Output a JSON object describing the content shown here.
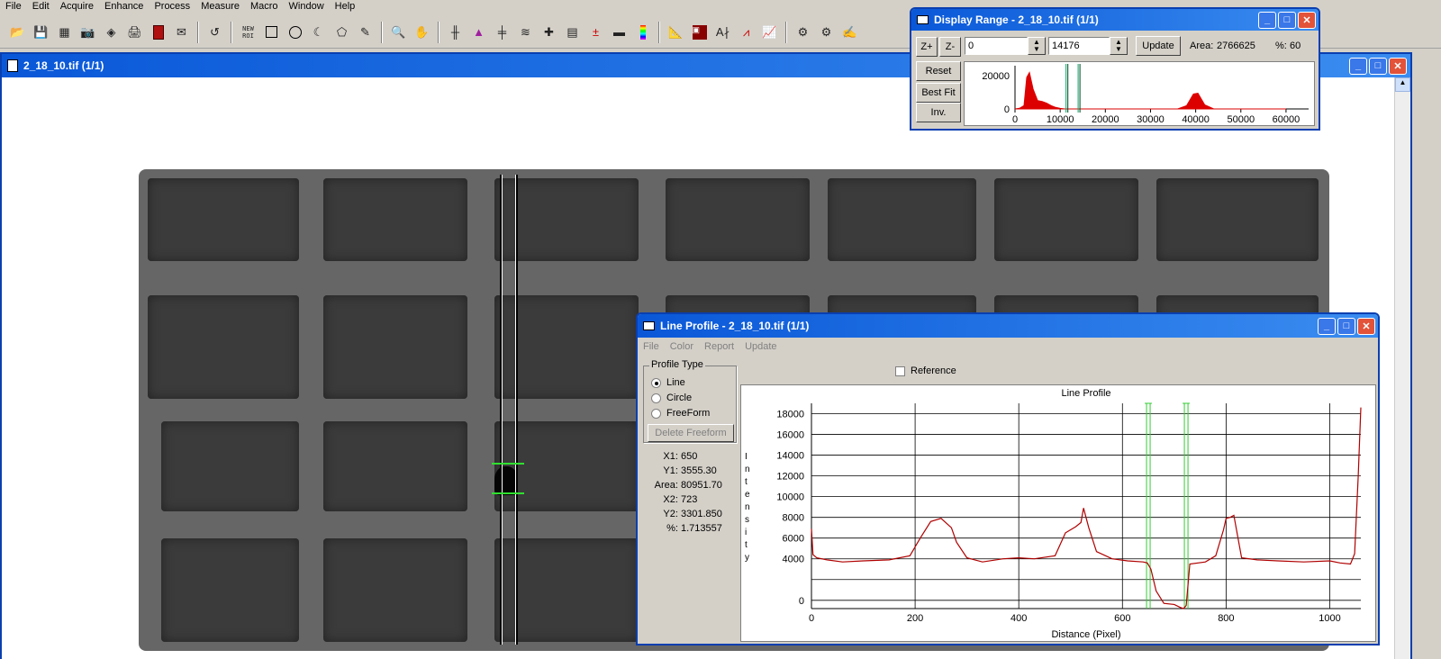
{
  "menu": [
    "File",
    "Edit",
    "Acquire",
    "Enhance",
    "Process",
    "Measure",
    "Macro",
    "Window",
    "Help"
  ],
  "toolbar": {
    "new_roi": "NEW\nROI"
  },
  "image_window": {
    "title": "2_18_10.tif (1/1)"
  },
  "display_range": {
    "title": "Display Range - 2_18_10.tif (1/1)",
    "zoom_in": "Z+",
    "zoom_out": "Z-",
    "min_value": "0",
    "max_value": "14176",
    "update_label": "Update",
    "area_label": "Area:",
    "area_value": "2766625",
    "percent_label": "%:",
    "percent_value": "60",
    "reset_label": "Reset",
    "best_fit_label": "Best Fit",
    "inv_label": "Inv.",
    "histogram": {
      "y_ticks": [
        "20000",
        "0"
      ],
      "x_ticks": [
        "0",
        "10000",
        "20000",
        "30000",
        "40000",
        "50000",
        "60000"
      ],
      "color": "#dd0000",
      "marker_color": "#00aa66"
    }
  },
  "line_profile": {
    "title": "Line Profile - 2_18_10.tif (1/1)",
    "menu": [
      "File",
      "Color",
      "Report",
      "Update"
    ],
    "profile_type_label": "Profile Type",
    "options": [
      "Line",
      "Circle",
      "FreeForm"
    ],
    "selected_option": "Line",
    "delete_freeform_label": "Delete Freeform",
    "reference_label": "Reference",
    "stats": [
      {
        "label": "X1:",
        "value": "650"
      },
      {
        "label": "Y1:",
        "value": "3555.30"
      },
      {
        "label": "Area:",
        "value": "80951.70"
      },
      {
        "label": "X2:",
        "value": "723"
      },
      {
        "label": "Y2:",
        "value": "3301.850"
      },
      {
        "label": "%:",
        "value": "1.713557"
      }
    ]
  },
  "chart_data": [
    {
      "type": "area",
      "title": "",
      "xlabel": "",
      "ylabel": "",
      "xlim": [
        0,
        65000
      ],
      "x_ticks": [
        0,
        10000,
        20000,
        30000,
        40000,
        50000,
        60000
      ],
      "y_ticks": [
        20000,
        0
      ],
      "x": [
        0,
        1000,
        2000,
        2600,
        3200,
        4000,
        5000,
        6000,
        7000,
        8000,
        9000,
        10000,
        11000,
        30000,
        36000,
        38000,
        39500,
        40500,
        42000,
        44000,
        60000
      ],
      "values": [
        0,
        400,
        2000,
        19000,
        22000,
        12000,
        5000,
        4500,
        3500,
        2000,
        900,
        300,
        0,
        0,
        0,
        2000,
        9000,
        9500,
        2500,
        0,
        0
      ],
      "markers": [
        11500,
        14176
      ]
    },
    {
      "type": "line",
      "title": "Line Profile",
      "xlabel": "Distance (Pixel)",
      "ylabel": "Intensity",
      "xlim": [
        0,
        1060
      ],
      "ylim": [
        -800,
        19000
      ],
      "x_ticks": [
        0,
        200,
        400,
        600,
        800,
        1000
      ],
      "y_ticks": [
        0,
        4000,
        6000,
        8000,
        10000,
        12000,
        14000,
        16000,
        18000
      ],
      "color": "#b00000",
      "markers": [
        650,
        723
      ],
      "x": [
        0,
        3,
        10,
        30,
        60,
        100,
        150,
        190,
        210,
        230,
        250,
        270,
        280,
        300,
        330,
        370,
        400,
        430,
        470,
        490,
        510,
        520,
        525,
        535,
        550,
        580,
        610,
        640,
        648,
        655,
        665,
        680,
        700,
        712,
        718,
        723,
        730,
        760,
        780,
        795,
        800,
        808,
        815,
        830,
        860,
        900,
        950,
        1000,
        1020,
        1040,
        1048,
        1055,
        1060
      ],
      "values": [
        6900,
        4400,
        4100,
        3900,
        3700,
        3800,
        3900,
        4300,
        6000,
        7600,
        7900,
        7000,
        5600,
        4100,
        3700,
        4000,
        4100,
        4000,
        4300,
        6500,
        7100,
        7500,
        8900,
        7000,
        4700,
        4000,
        3800,
        3700,
        3600,
        3000,
        900,
        -300,
        -400,
        -700,
        -800,
        -500,
        3500,
        3700,
        4300,
        6800,
        7900,
        8000,
        8200,
        4100,
        3900,
        3800,
        3700,
        3800,
        3600,
        3500,
        4500,
        12000,
        18600
      ]
    }
  ]
}
